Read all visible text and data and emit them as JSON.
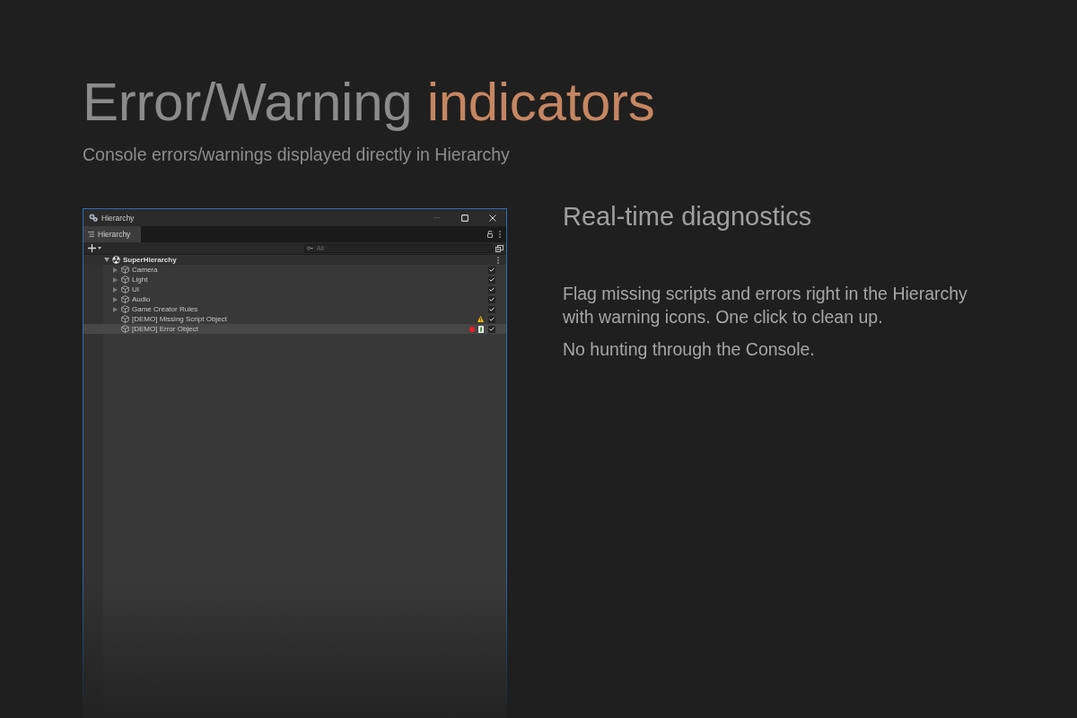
{
  "heading": {
    "title": "Error/Warning",
    "highlight": "indicators",
    "subtitle": "Console errors/warnings displayed directly in Hierarchy"
  },
  "window": {
    "title": "Hierarchy",
    "tabs": [
      {
        "label": "Hierarchy",
        "selected": true
      }
    ],
    "search": {
      "placeholder": "All"
    },
    "root": {
      "label": "SuperHierarchy",
      "expanded": true,
      "children": [
        {
          "label": "Camera",
          "kind": "group",
          "expanded": false,
          "checked": true,
          "selected": false
        },
        {
          "label": "Light",
          "kind": "group",
          "expanded": false,
          "checked": true,
          "selected": false
        },
        {
          "label": "UI",
          "kind": "group",
          "expanded": false,
          "checked": true,
          "selected": false
        },
        {
          "label": "Audio",
          "kind": "group",
          "expanded": false,
          "checked": true,
          "selected": false
        },
        {
          "label": "Game Creator Rules",
          "kind": "group",
          "expanded": false,
          "checked": true,
          "selected": false
        },
        {
          "label": "[DEMO] Missing Script Object",
          "kind": "object",
          "checked": true,
          "selected": false,
          "indicators": [
            {
              "kind": "warning"
            }
          ]
        },
        {
          "label": "[DEMO] Error Object",
          "kind": "object",
          "checked": true,
          "selected": true,
          "indicators": [
            {
              "kind": "error"
            },
            {
              "kind": "script"
            }
          ]
        }
      ]
    }
  },
  "feature": {
    "title": "Real-time diagnostics",
    "paragraphs": [
      "Flag missing scripts and errors right in the Hierarchy with warning icons. One click to clean up.",
      "No hunting through the Console."
    ]
  }
}
